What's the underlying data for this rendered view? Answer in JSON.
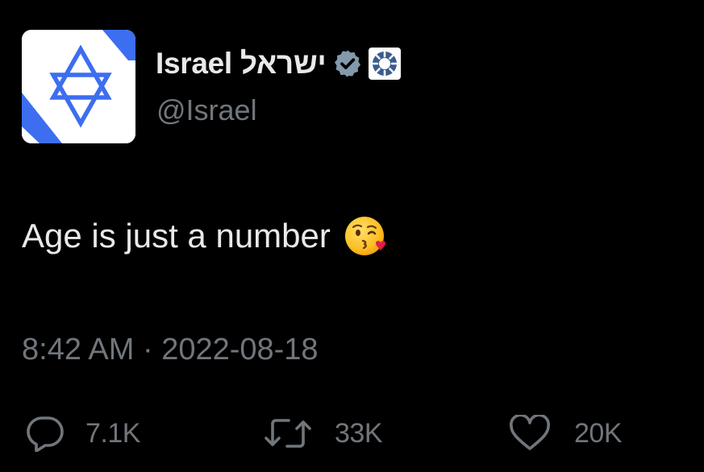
{
  "account": {
    "display_name": "Israel ישראל",
    "handle": "@Israel",
    "avatar_icon": "star-of-david-flag-icon",
    "verified_icon": "verified-badge-icon",
    "affiliate_icon": "government-affiliate-icon"
  },
  "tweet": {
    "text": "Age is just a number",
    "emoji": "kissing-face-emoji-icon",
    "timestamp": "8:42 AM · 2022-08-18"
  },
  "actions": {
    "reply_count": "7.1K",
    "retweet_count": "33K",
    "like_count": "20K"
  },
  "colors": {
    "background": "#000000",
    "primary_text": "#e7e9ea",
    "secondary_text": "#71767b",
    "flag_blue": "#3d6ef0"
  }
}
